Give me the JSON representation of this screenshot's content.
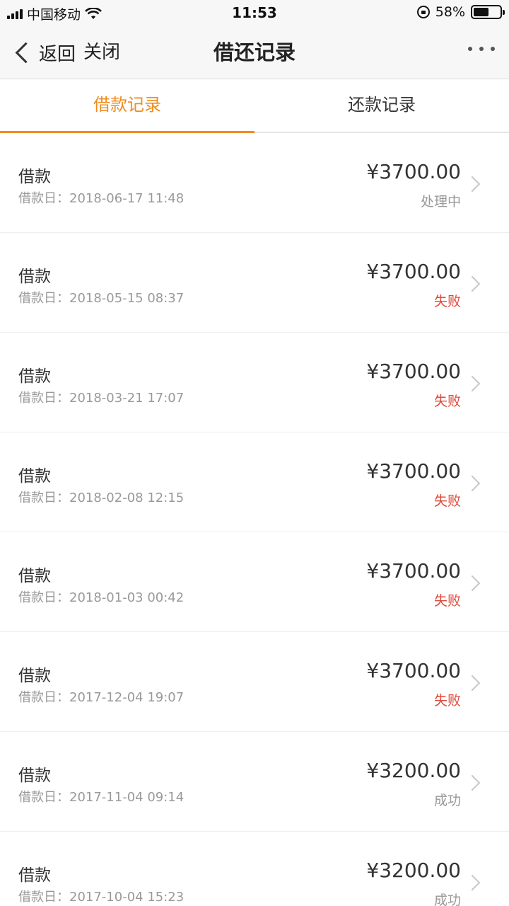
{
  "status_bar": {
    "carrier": "中国移动",
    "time": "11:53",
    "battery": "58%",
    "battery_level": 0.58
  },
  "nav": {
    "back_label": "返回",
    "close_label": "关闭",
    "title": "借还记录"
  },
  "tabs": [
    {
      "label": "借款记录",
      "active": true
    },
    {
      "label": "还款记录",
      "active": false
    }
  ],
  "records": [
    {
      "title": "借款",
      "date_label": "借款日：",
      "date": "2018-06-17 11:48",
      "amount": "¥3700.00",
      "status": "处理中",
      "status_type": "pending"
    },
    {
      "title": "借款",
      "date_label": "借款日：",
      "date": "2018-05-15 08:37",
      "amount": "¥3700.00",
      "status": "失败",
      "status_type": "fail"
    },
    {
      "title": "借款",
      "date_label": "借款日：",
      "date": "2018-03-21 17:07",
      "amount": "¥3700.00",
      "status": "失败",
      "status_type": "fail"
    },
    {
      "title": "借款",
      "date_label": "借款日：",
      "date": "2018-02-08 12:15",
      "amount": "¥3700.00",
      "status": "失败",
      "status_type": "fail"
    },
    {
      "title": "借款",
      "date_label": "借款日：",
      "date": "2018-01-03 00:42",
      "amount": "¥3700.00",
      "status": "失败",
      "status_type": "fail"
    },
    {
      "title": "借款",
      "date_label": "借款日：",
      "date": "2017-12-04 19:07",
      "amount": "¥3700.00",
      "status": "失败",
      "status_type": "fail"
    },
    {
      "title": "借款",
      "date_label": "借款日：",
      "date": "2017-11-04 09:14",
      "amount": "¥3200.00",
      "status": "成功",
      "status_type": "success"
    },
    {
      "title": "借款",
      "date_label": "借款日：",
      "date": "2017-10-04 15:23",
      "amount": "¥3200.00",
      "status": "成功",
      "status_type": "success"
    }
  ],
  "colors": {
    "accent": "#f08c1f",
    "fail": "#e04a3b",
    "muted": "#999999"
  }
}
